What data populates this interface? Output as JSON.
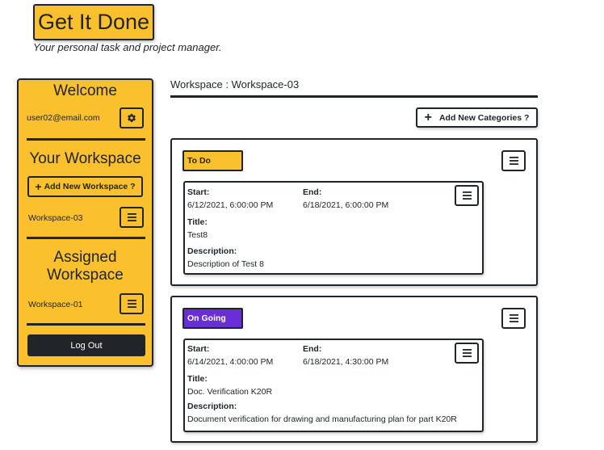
{
  "app": {
    "title": "Get It Done",
    "tagline": "Your personal task and project manager."
  },
  "sidebar": {
    "welcome_heading": "Welcome",
    "user_email": "user02@email.com",
    "settings_icon": "gear-icon",
    "workspace_heading": "Your Workspace",
    "add_workspace_label": "Add New Workspace ?",
    "workspaces": [
      "Workspace-03"
    ],
    "assigned_heading": "Assigned Workspace",
    "assigned_workspaces": [
      "Workspace-01"
    ],
    "logout_label": "Log Out",
    "menu_icon": "hamburger-menu-icon"
  },
  "main": {
    "workspace_title": "Workspace : Workspace-03",
    "add_category_label": "Add New Categories ?",
    "categories": [
      {
        "label": "To Do",
        "color": "#fbc02d",
        "text_color": "#212529",
        "tasks": [
          {
            "start_label": "Start:",
            "start": "6/12/2021, 6:00:00 PM",
            "end_label": "End:",
            "end": "6/18/2021, 6:00:00 PM",
            "title_label": "Title:",
            "title": "Test8",
            "description_label": "Description:",
            "description": "Description of Test 8"
          }
        ]
      },
      {
        "label": "On Going",
        "color": "#6a2ed6",
        "text_color": "#ffffff",
        "tasks": [
          {
            "start_label": "Start:",
            "start": "6/14/2021, 4:00:00 PM",
            "end_label": "End:",
            "end": "6/18/2021, 4:30:00 PM",
            "title_label": "Title:",
            "title": "Doc. Verification K20R",
            "description_label": "Description:",
            "description": "Document verification for drawing and manufacturing plan for part K20R"
          }
        ]
      }
    ]
  },
  "colors": {
    "accent": "#fbc02d",
    "dark": "#212529",
    "ongoing": "#6a2ed6"
  }
}
